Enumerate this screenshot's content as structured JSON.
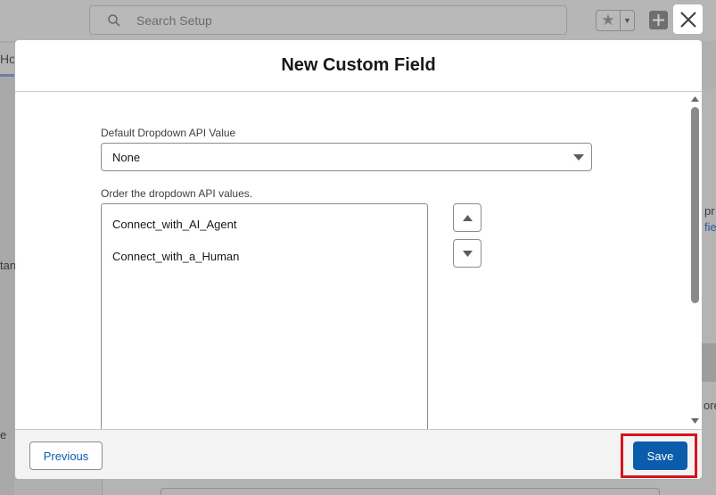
{
  "background": {
    "search_placeholder": "Search Setup",
    "left_tab_fragment": "Ho",
    "left_fragment_mid": "tan",
    "left_fragment_low": "e",
    "right_fragment_1": "pr",
    "right_fragment_2": "fie",
    "right_fragment_3": "ore"
  },
  "modal": {
    "title": "New Custom Field",
    "default_value_label": "Default Dropdown API Value",
    "default_value_selected": "None",
    "order_label": "Order the dropdown API values.",
    "options": [
      "Connect_with_AI_Agent",
      "Connect_with_a_Human"
    ],
    "footer": {
      "previous_label": "Previous",
      "save_label": "Save"
    }
  },
  "colors": {
    "brand": "#0b5cab",
    "highlight": "#d4141f"
  }
}
